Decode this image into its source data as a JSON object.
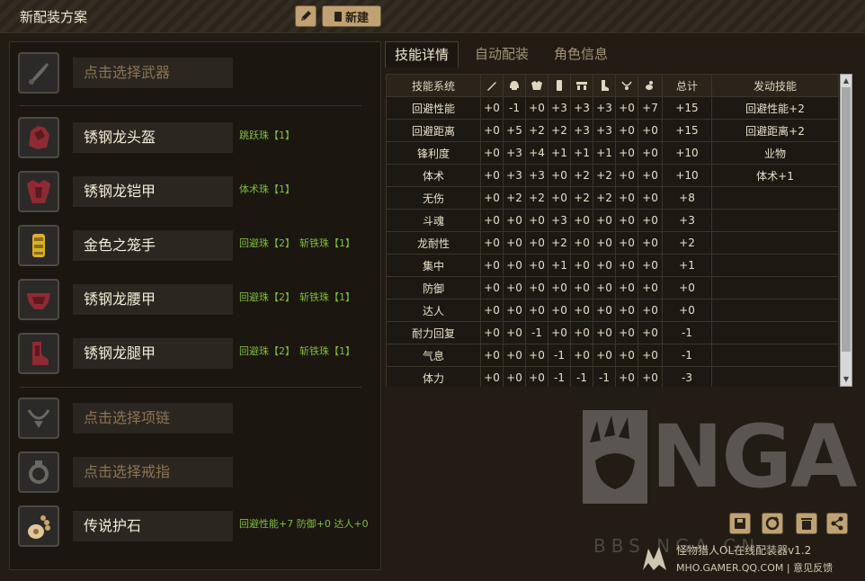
{
  "app": {
    "title": "新配装方案",
    "new_button": "新建"
  },
  "slots": [
    {
      "name": "点击选择武器",
      "decorations": []
    },
    {
      "name": "锈钢龙头盔",
      "decorations": [
        "跳跃珠【1】"
      ]
    },
    {
      "name": "锈钢龙铠甲",
      "decorations": [
        "体术珠【1】"
      ]
    },
    {
      "name": "金色之笼手",
      "decorations": [
        "回避珠【2】",
        "斩铁珠【1】"
      ]
    },
    {
      "name": "锈钢龙腰甲",
      "decorations": [
        "回避珠【2】",
        "斩铁珠【1】"
      ]
    },
    {
      "name": "锈钢龙腿甲",
      "decorations": [
        "回避珠【2】",
        "斩铁珠【1】"
      ]
    },
    {
      "name": "点击选择项链",
      "decorations": []
    },
    {
      "name": "点击选择戒指",
      "decorations": []
    },
    {
      "name": "传说护石",
      "decorations": [
        "回避性能+7 防御+0 达人+0"
      ]
    }
  ],
  "tabs": [
    "技能详情",
    "自动配装",
    "角色信息"
  ],
  "table": {
    "headers": {
      "skill": "技能系统",
      "total": "总计",
      "activated": "发动技能"
    },
    "column_icons": [
      "weapon-icon",
      "helmet-icon",
      "chest-icon",
      "arm-icon",
      "waist-icon",
      "leg-icon",
      "amulet-icon",
      "gem-icon"
    ],
    "rows": [
      {
        "name": "回避性能",
        "values": [
          "+0",
          "-1",
          "+0",
          "+3",
          "+3",
          "+3",
          "+0",
          "+7"
        ],
        "total": "+15",
        "activated": "回避性能+2"
      },
      {
        "name": "回避距离",
        "values": [
          "+0",
          "+5",
          "+2",
          "+2",
          "+3",
          "+3",
          "+0",
          "+0"
        ],
        "total": "+15",
        "activated": "回避距离+2"
      },
      {
        "name": "锋利度",
        "values": [
          "+0",
          "+3",
          "+4",
          "+1",
          "+1",
          "+1",
          "+0",
          "+0"
        ],
        "total": "+10",
        "activated": "业物"
      },
      {
        "name": "体术",
        "values": [
          "+0",
          "+3",
          "+3",
          "+0",
          "+2",
          "+2",
          "+0",
          "+0"
        ],
        "total": "+10",
        "activated": "体术+1"
      },
      {
        "name": "无伤",
        "values": [
          "+0",
          "+2",
          "+2",
          "+0",
          "+2",
          "+2",
          "+0",
          "+0"
        ],
        "total": "+8",
        "activated": ""
      },
      {
        "name": "斗魂",
        "values": [
          "+0",
          "+0",
          "+0",
          "+3",
          "+0",
          "+0",
          "+0",
          "+0"
        ],
        "total": "+3",
        "activated": ""
      },
      {
        "name": "龙耐性",
        "values": [
          "+0",
          "+0",
          "+0",
          "+2",
          "+0",
          "+0",
          "+0",
          "+0"
        ],
        "total": "+2",
        "activated": ""
      },
      {
        "name": "集中",
        "values": [
          "+0",
          "+0",
          "+0",
          "+1",
          "+0",
          "+0",
          "+0",
          "+0"
        ],
        "total": "+1",
        "activated": ""
      },
      {
        "name": "防御",
        "values": [
          "+0",
          "+0",
          "+0",
          "+0",
          "+0",
          "+0",
          "+0",
          "+0"
        ],
        "total": "+0",
        "activated": ""
      },
      {
        "name": "达人",
        "values": [
          "+0",
          "+0",
          "+0",
          "+0",
          "+0",
          "+0",
          "+0",
          "+0"
        ],
        "total": "+0",
        "activated": ""
      },
      {
        "name": "耐力回复",
        "values": [
          "+0",
          "+0",
          "-1",
          "+0",
          "+0",
          "+0",
          "+0",
          "+0"
        ],
        "total": "-1",
        "activated": ""
      },
      {
        "name": "气息",
        "values": [
          "+0",
          "+0",
          "+0",
          "-1",
          "+0",
          "+0",
          "+0",
          "+0"
        ],
        "total": "-1",
        "activated": ""
      },
      {
        "name": "体力",
        "values": [
          "+0",
          "+0",
          "+0",
          "-1",
          "-1",
          "-1",
          "+0",
          "+0"
        ],
        "total": "-3",
        "activated": ""
      }
    ]
  },
  "watermark": {
    "letters": "NGA",
    "sub": "BBS.NGA.CN"
  },
  "footer": {
    "title": "怪物猎人OL在线配装器v1.2",
    "site": "MHO.GAMER.QQ.COM",
    "separator": "|",
    "feedback": "意见反馈"
  },
  "colors": {
    "accent": "#bfa173",
    "decoration_text": "#7fbf3a",
    "armor_red": "#8e2a33",
    "gold": "#d9b12a"
  }
}
